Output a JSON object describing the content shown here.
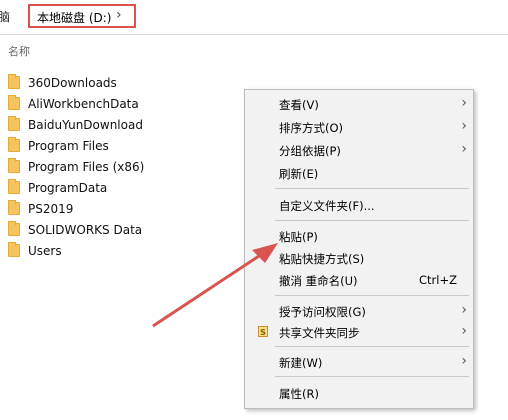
{
  "address_bar": {
    "left_fragment": "脑",
    "path_label": "本地磁盘 (D:)",
    "chevron": "›"
  },
  "column_header": "名称",
  "files": [
    {
      "name": "360Downloads"
    },
    {
      "name": "AliWorkbenchData"
    },
    {
      "name": "BaiduYunDownload"
    },
    {
      "name": "Program Files"
    },
    {
      "name": "Program Files (x86)"
    },
    {
      "name": "ProgramData"
    },
    {
      "name": "PS2019"
    },
    {
      "name": "SOLIDWORKS Data"
    },
    {
      "name": "Users"
    }
  ],
  "context_menu": {
    "items": [
      {
        "label": "查看(V)",
        "submenu": true
      },
      {
        "label": "排序方式(O)",
        "submenu": true
      },
      {
        "label": "分组依据(P)",
        "submenu": true
      },
      {
        "label": "刷新(E)"
      },
      {
        "label": "自定义文件夹(F)..."
      },
      {
        "label": "粘贴(P)"
      },
      {
        "label": "粘贴快捷方式(S)"
      },
      {
        "label": "撤消 重命名(U)",
        "shortcut": "Ctrl+Z"
      },
      {
        "label": "授予访问权限(G)",
        "submenu": true
      },
      {
        "label": "共享文件夹同步",
        "submenu": true,
        "icon": "S"
      },
      {
        "label": "新建(W)",
        "submenu": true
      },
      {
        "label": "属性(R)"
      }
    ]
  },
  "colors": {
    "highlight_box": "#d9534f",
    "arrow": "#d9534f",
    "folder": "#f6c45e",
    "menu_bg": "#f2f2f2"
  }
}
